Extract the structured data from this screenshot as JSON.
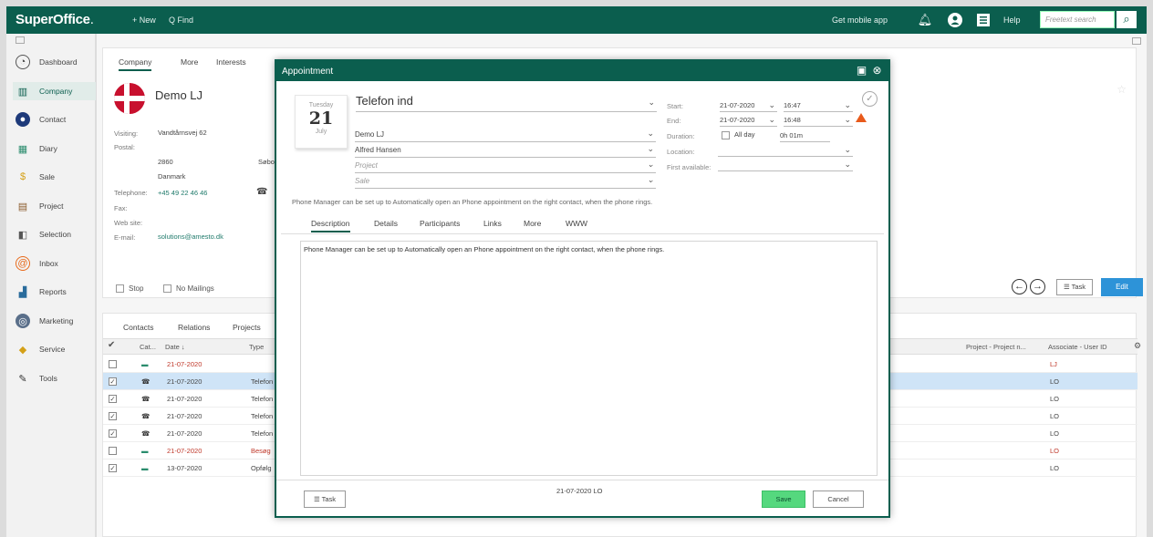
{
  "topbar": {
    "logo": "SuperOffice",
    "logo_dot": ".",
    "new_label": "+ New",
    "find_label": "Q Find",
    "mobile_app": "Get mobile app",
    "help": "Help",
    "search_placeholder": "Freetext search"
  },
  "sidebar": {
    "items": [
      {
        "label": "Dashboard",
        "icon": "dashboard-icon"
      },
      {
        "label": "Company",
        "icon": "company-icon"
      },
      {
        "label": "Contact",
        "icon": "contact-icon"
      },
      {
        "label": "Diary",
        "icon": "diary-icon"
      },
      {
        "label": "Sale",
        "icon": "sale-icon"
      },
      {
        "label": "Project",
        "icon": "project-icon"
      },
      {
        "label": "Selection",
        "icon": "selection-icon"
      },
      {
        "label": "Inbox",
        "icon": "inbox-icon"
      },
      {
        "label": "Reports",
        "icon": "reports-icon"
      },
      {
        "label": "Marketing",
        "icon": "marketing-icon"
      },
      {
        "label": "Service",
        "icon": "service-icon"
      },
      {
        "label": "Tools",
        "icon": "tools-icon"
      }
    ]
  },
  "company": {
    "tabs": [
      "Company",
      "More",
      "Interests"
    ],
    "name": "Demo LJ",
    "visiting_label": "Visiting:",
    "visiting_value": "Vandtårnsvej 62",
    "postal_label": "Postal:",
    "zip": "2860",
    "city": "Søbo",
    "country": "Danmark",
    "phone_label": "Telephone:",
    "phone_value": "+45 49 22 46 46",
    "fax_label": "Fax:",
    "web_label": "Web site:",
    "email_label": "E-mail:",
    "email_value": "solutions@amesto.dk",
    "stop_label": "Stop",
    "no_mailings_label": "No Mailings",
    "task_button": "☰ Task",
    "edit_button": "Edit"
  },
  "list": {
    "tabs": [
      "Contacts",
      "Relations",
      "Projects"
    ],
    "headers": {
      "cat": "Cat...",
      "date": "Date ↓",
      "type": "Type",
      "project": "Project - Project n...",
      "associate": "Associate - User ID"
    },
    "rows": [
      {
        "date": "21-07-2020",
        "type": "",
        "assoc": "LJ",
        "checked": false,
        "red": true,
        "icon": "▬"
      },
      {
        "date": "21-07-2020",
        "type": "Telefon",
        "assoc": "LO",
        "checked": true,
        "red": false,
        "icon": "☎"
      },
      {
        "date": "21-07-2020",
        "type": "Telefon",
        "assoc": "LO",
        "checked": true,
        "red": false,
        "icon": "☎"
      },
      {
        "date": "21-07-2020",
        "type": "Telefon",
        "assoc": "LO",
        "checked": true,
        "red": false,
        "icon": "☎"
      },
      {
        "date": "21-07-2020",
        "type": "Telefon",
        "assoc": "LO",
        "checked": true,
        "red": false,
        "icon": "☎"
      },
      {
        "date": "21-07-2020",
        "type": "Besøg",
        "assoc": "LO",
        "checked": false,
        "red": true,
        "icon": "▬"
      },
      {
        "date": "13-07-2020",
        "type": "Opfølg",
        "assoc": "LO",
        "checked": true,
        "red": false,
        "icon": "▬"
      }
    ]
  },
  "appointment": {
    "title_bar": "Appointment",
    "date_card": {
      "weekday": "Tuesday",
      "day": "21",
      "month": "July"
    },
    "title": "Telefon ind",
    "company": "Demo LJ",
    "contact": "Alfred Hansen",
    "project_placeholder": "Project",
    "sale_placeholder": "Sale",
    "start_label": "Start:",
    "start_date": "21-07-2020",
    "start_time": "16:47",
    "end_label": "End:",
    "end_date": "21-07-2020",
    "end_time": "16:48",
    "duration_label": "Duration:",
    "all_day_label": "All day",
    "duration_value": "0h 01m",
    "location_label": "Location:",
    "first_available_label": "First available:",
    "info_text": "Phone Manager can be set up to Automatically open an Phone appointment on the right contact, when the phone rings.",
    "tabs": [
      "Description",
      "Details",
      "Participants",
      "Links",
      "More",
      "WWW"
    ],
    "description": "Phone Manager can be set up to Automatically open an Phone appointment on the right contact, when the phone rings.",
    "footer_info": "21-07-2020 LO",
    "task_button": "☰ Task",
    "save_button": "Save",
    "cancel_button": "Cancel"
  },
  "colors": {
    "brand": "#0b5e4e",
    "edit": "#2d93d8",
    "save": "#55d87e",
    "warning": "#e85a1b"
  }
}
